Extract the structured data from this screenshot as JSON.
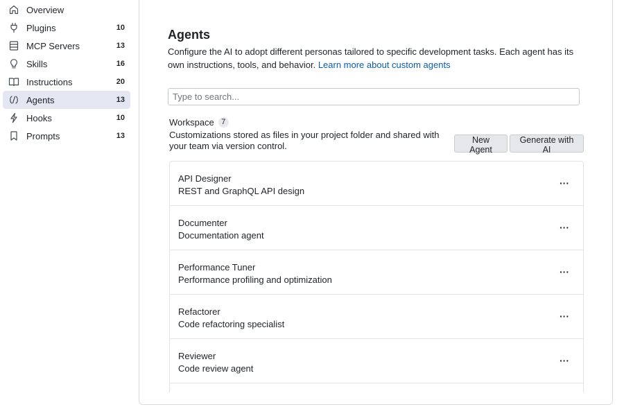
{
  "sidebar": {
    "items": [
      {
        "label": "Overview",
        "count": "",
        "icon": "home-icon"
      },
      {
        "label": "Plugins",
        "count": "10",
        "icon": "plug-icon"
      },
      {
        "label": "MCP Servers",
        "count": "13",
        "icon": "server-icon"
      },
      {
        "label": "Skills",
        "count": "16",
        "icon": "lightbulb-icon"
      },
      {
        "label": "Instructions",
        "count": "20",
        "icon": "book-icon"
      },
      {
        "label": "Agents",
        "count": "13",
        "icon": "agent-icon"
      },
      {
        "label": "Hooks",
        "count": "10",
        "icon": "lightning-icon"
      },
      {
        "label": "Prompts",
        "count": "13",
        "icon": "bookmark-icon"
      }
    ],
    "active_index": 5
  },
  "main": {
    "title": "Agents",
    "description": "Configure the AI to adopt different personas tailored to specific development tasks. Each agent has its own instructions, tools, and behavior.",
    "learn_more_link": "Learn more about custom agents",
    "search_placeholder": "Type to search..."
  },
  "workspace": {
    "title": "Workspace",
    "count": "7",
    "description": "Customizations stored as files in your project folder and shared with your team via version control.",
    "new_button": "New Agent",
    "generate_button": "Generate with AI"
  },
  "agents": [
    {
      "name": "API Designer",
      "description": "REST and GraphQL API design",
      "more": "···"
    },
    {
      "name": "Documenter",
      "description": "Documentation agent",
      "more": "···"
    },
    {
      "name": "Performance Tuner",
      "description": "Performance profiling and optimization",
      "more": "···"
    },
    {
      "name": "Refactorer",
      "description": "Code refactoring specialist",
      "more": "···"
    },
    {
      "name": "Reviewer",
      "description": "Code review agent",
      "more": "···"
    }
  ],
  "colors": {
    "active_nav_bg": "#e4e6f1",
    "link": "#0b5cad",
    "border": "#d8dbe0"
  }
}
